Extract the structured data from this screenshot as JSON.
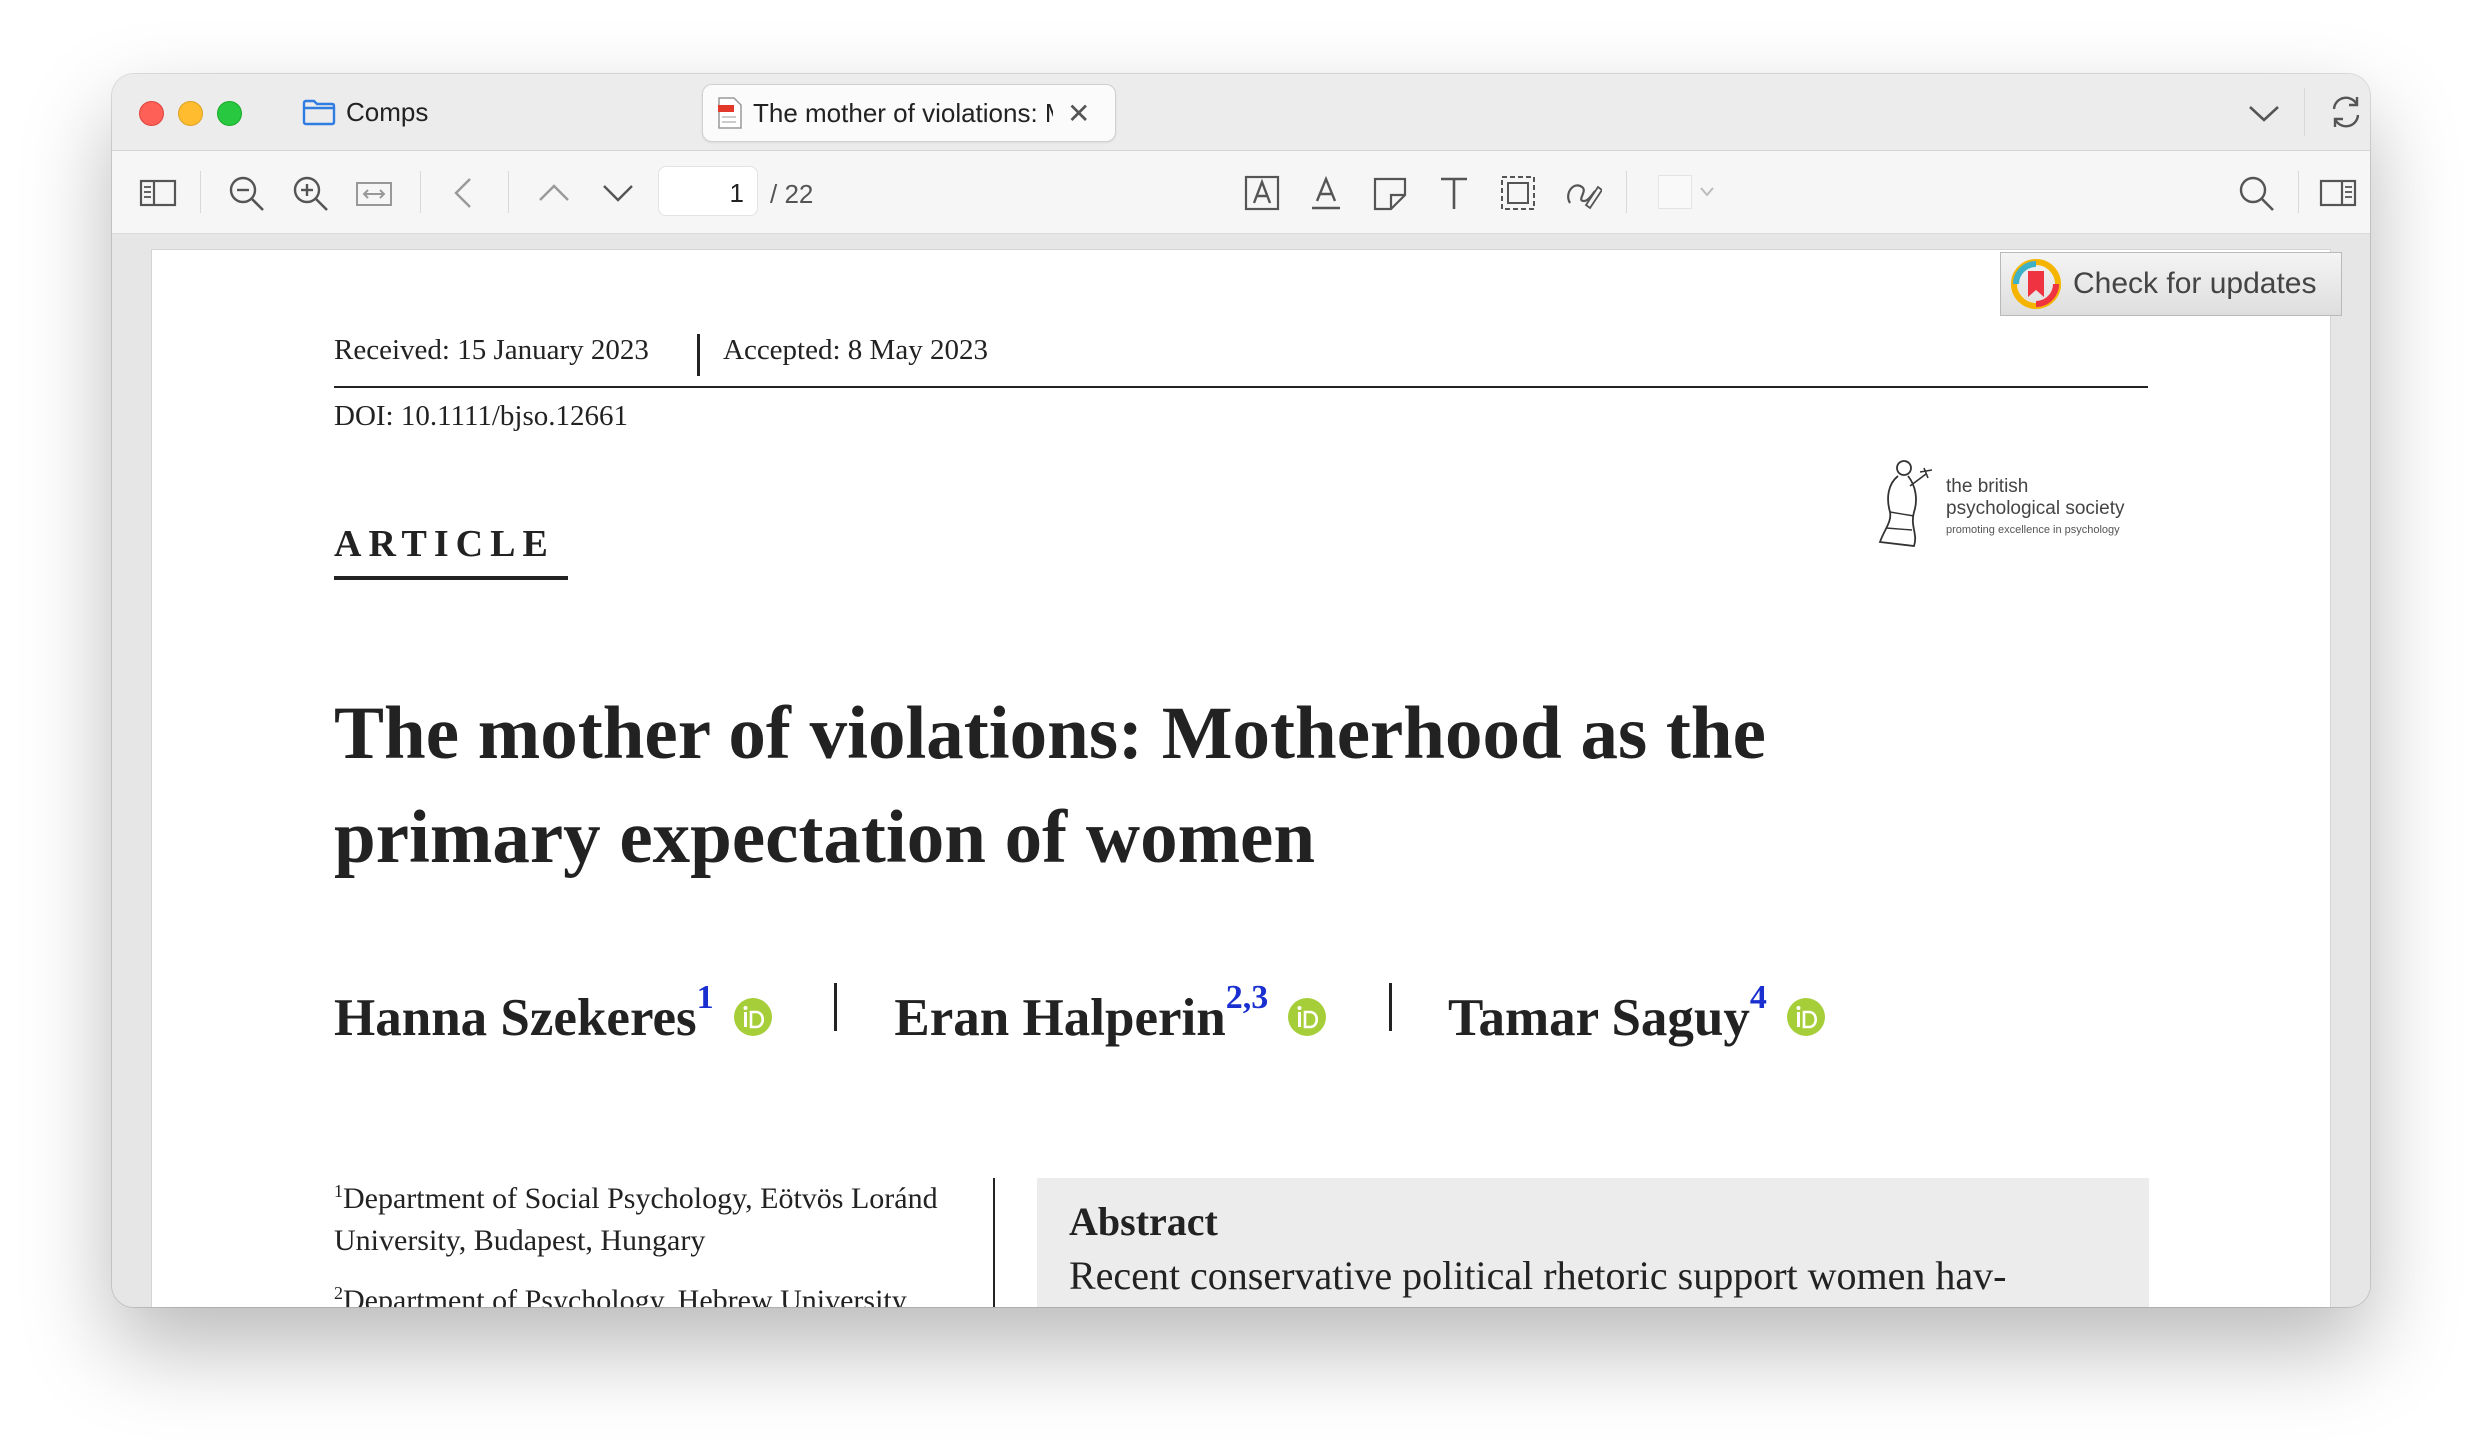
{
  "window": {
    "folder_tab_label": "Comps",
    "document_tab_label": "The mother of violations: Motherhood as the primary expectation of women"
  },
  "toolbar": {
    "page_current": "1",
    "page_total": "/ 22"
  },
  "overlay": {
    "check_updates_label": "Check for updates"
  },
  "paper": {
    "received": "Received: 15 January 2023",
    "accepted": "Accepted: 8 May 2023",
    "doi": "DOI: 10.1111/bjso.12661",
    "publisher": {
      "line1": "the british",
      "line2": "psychological society",
      "tagline": "promoting excellence in psychology"
    },
    "article_label": "ARTICLE",
    "title": "The mother of violations: Motherhood as the primary expectation of women",
    "authors": [
      {
        "name": "Hanna Szekeres",
        "sup": "1"
      },
      {
        "name": "Eran Halperin",
        "sup": "2,3"
      },
      {
        "name": "Tamar Saguy",
        "sup": "4"
      }
    ],
    "affiliations": [
      {
        "sup": "1",
        "text": "Department of Social Psychology, Eötvös Loránd University, Budapest, Hungary"
      },
      {
        "sup": "2",
        "text": "Department of Psychology, Hebrew University,"
      }
    ],
    "abstract_heading": "Abstract",
    "abstract_text": "Recent conservative political rhetoric support women hav-"
  },
  "colors": {
    "link_superscript": "#1a2fd0",
    "orcid_green": "#a6ce39",
    "abstract_bg": "#ececec"
  }
}
